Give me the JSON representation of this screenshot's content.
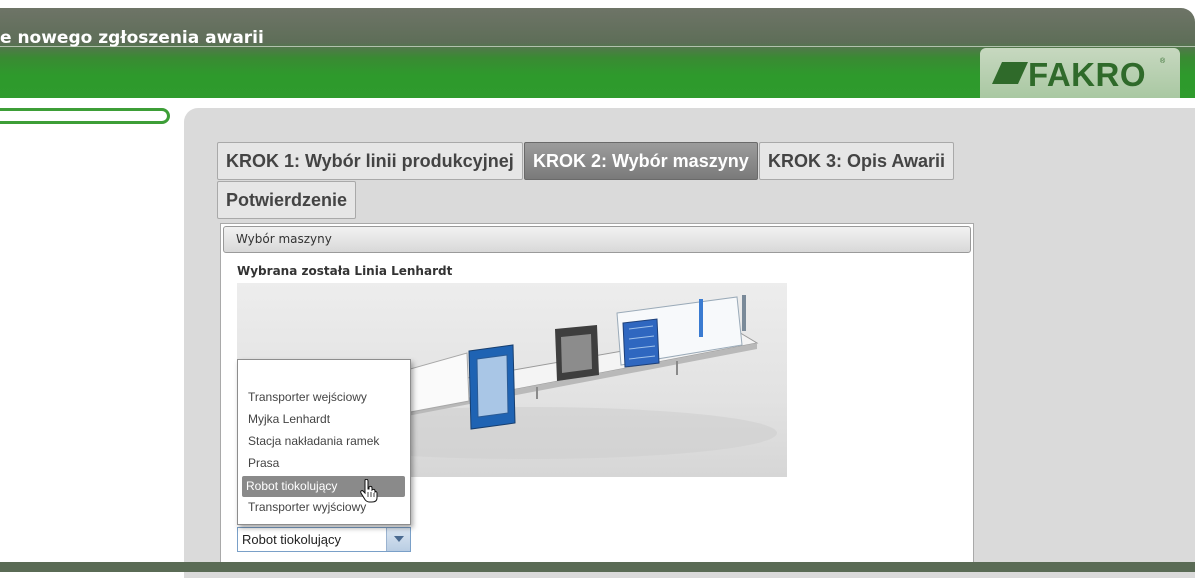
{
  "header": {
    "title": "e nowego zgłoszenia awarii",
    "logo_text": "FAKRO",
    "logo_reg": "®"
  },
  "tabs": [
    {
      "label": "KROK 1: Wybór linii produkcyjnej",
      "active": false
    },
    {
      "label": "KROK 2: Wybór maszyny",
      "active": true
    },
    {
      "label": "KROK 3: Opis Awarii",
      "active": false
    },
    {
      "label": "Potwierdzenie",
      "active": false
    }
  ],
  "section": {
    "title": "Wybór maszyny",
    "selected_line": "Wybrana została Linia Lenhardt",
    "field_label_tail": "o",
    "required_mark": "*"
  },
  "select": {
    "value": "Robot tiokolujący"
  },
  "dropdown": {
    "options": [
      "",
      "Transporter wejściowy",
      "Myjka Lenhardt",
      "Stacja nakładania ramek",
      "Prasa",
      "Robot tiokolujący",
      "Transporter wyjściowy"
    ],
    "highlighted_index": 5
  },
  "colors": {
    "brand_green": "#2f9b2d",
    "logo_green": "#2f6a2a",
    "active_tab": "#7a7a7a",
    "panel_gray": "#dadada"
  }
}
